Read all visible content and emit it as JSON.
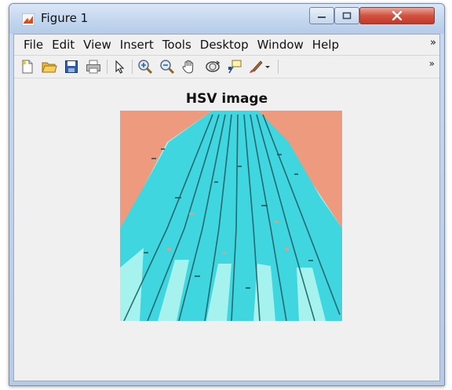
{
  "window": {
    "title": "Figure 1",
    "controls": [
      "minimize",
      "maximize",
      "close"
    ]
  },
  "menubar": {
    "items": [
      {
        "label": "File"
      },
      {
        "label": "Edit"
      },
      {
        "label": "View"
      },
      {
        "label": "Insert"
      },
      {
        "label": "Tools"
      },
      {
        "label": "Desktop"
      },
      {
        "label": "Window"
      },
      {
        "label": "Help"
      }
    ],
    "overflow": "»"
  },
  "toolbar": {
    "buttons": [
      {
        "icon": "new-figure-icon"
      },
      {
        "icon": "open-file-icon"
      },
      {
        "icon": "save-icon"
      },
      {
        "icon": "print-icon"
      },
      {
        "icon": "pointer-icon"
      },
      {
        "icon": "zoom-in-icon"
      },
      {
        "icon": "zoom-out-icon"
      },
      {
        "icon": "pan-hand-icon"
      },
      {
        "icon": "rotate-3d-icon"
      },
      {
        "icon": "data-cursor-icon"
      },
      {
        "icon": "brush-icon"
      }
    ],
    "overflow": "»"
  },
  "figure": {
    "axes_title": "HSV image"
  },
  "colors": {
    "figure_background": "#f0f0f0",
    "image_cyan": "#3fd6df",
    "image_salmon": "#ee9a7e",
    "image_pale_cyan": "#a6f2ee",
    "image_dark_edge": "#215f66"
  }
}
